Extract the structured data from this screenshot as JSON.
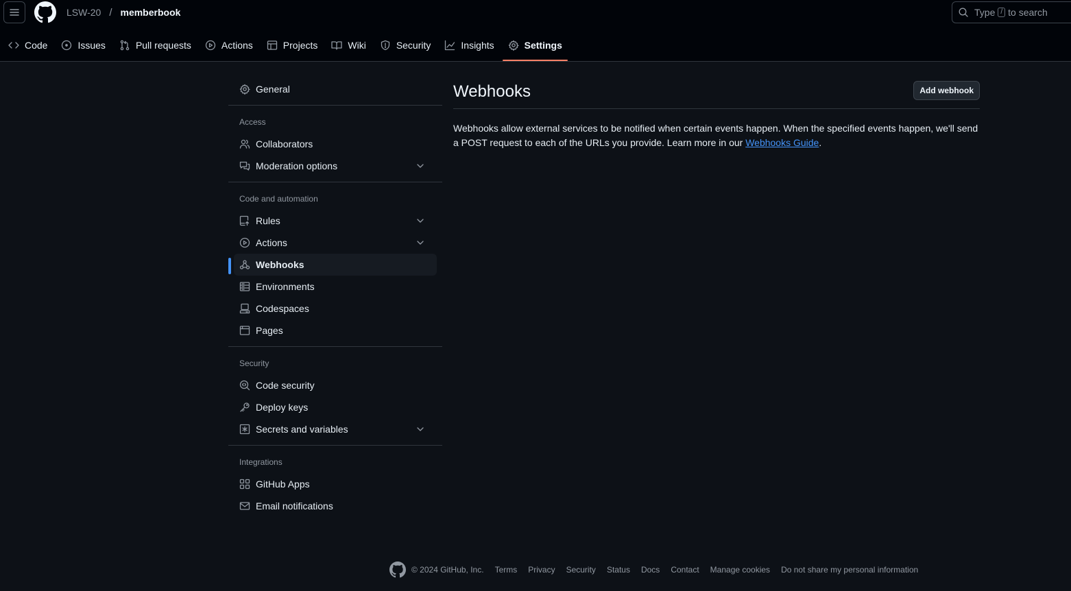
{
  "header": {
    "owner": "LSW-20",
    "separator": "/",
    "repo": "memberbook",
    "search_prefix": "Type",
    "search_key": "/",
    "search_suffix": "to search"
  },
  "tabs": [
    {
      "label": "Code",
      "icon": "code-icon"
    },
    {
      "label": "Issues",
      "icon": "issue-icon"
    },
    {
      "label": "Pull requests",
      "icon": "pull-request-icon"
    },
    {
      "label": "Actions",
      "icon": "play-icon"
    },
    {
      "label": "Projects",
      "icon": "table-icon"
    },
    {
      "label": "Wiki",
      "icon": "book-icon"
    },
    {
      "label": "Security",
      "icon": "shield-icon"
    },
    {
      "label": "Insights",
      "icon": "graph-icon"
    },
    {
      "label": "Settings",
      "icon": "gear-icon",
      "active": true
    }
  ],
  "sidebar": {
    "general": "General",
    "access": {
      "heading": "Access",
      "collaborators": "Collaborators",
      "moderation": "Moderation options"
    },
    "code_automation": {
      "heading": "Code and automation",
      "rules": "Rules",
      "actions": "Actions",
      "webhooks": "Webhooks",
      "environments": "Environments",
      "codespaces": "Codespaces",
      "pages": "Pages"
    },
    "security": {
      "heading": "Security",
      "code_security": "Code security",
      "deploy_keys": "Deploy keys",
      "secrets": "Secrets and variables"
    },
    "integrations": {
      "heading": "Integrations",
      "github_apps": "GitHub Apps",
      "email_notifications": "Email notifications"
    }
  },
  "main": {
    "title": "Webhooks",
    "add_button": "Add webhook",
    "description_before": "Webhooks allow external services to be notified when certain events happen. When the specified events happen, we'll send a POST request to each of the URLs you provide. Learn more in our ",
    "description_link": "Webhooks Guide",
    "description_after": "."
  },
  "footer": {
    "copyright": "© 2024 GitHub, Inc.",
    "links": [
      "Terms",
      "Privacy",
      "Security",
      "Status",
      "Docs",
      "Contact",
      "Manage cookies",
      "Do not share my personal information"
    ]
  },
  "colors": {
    "background": "#0d1117",
    "header_background": "#010409",
    "active_tab_underline": "#f78166",
    "active_nav_marker": "#4493f8",
    "link": "#4493f8"
  }
}
